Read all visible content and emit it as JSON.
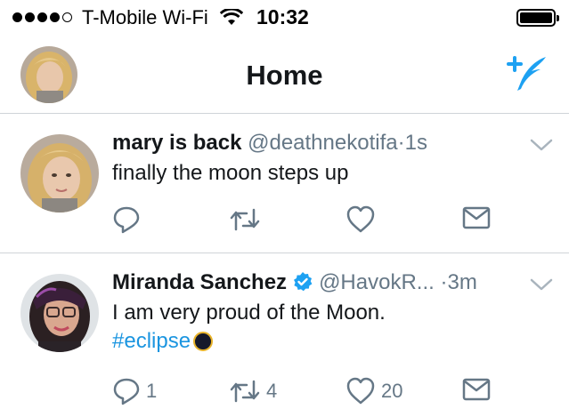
{
  "status_bar": {
    "carrier": "T-Mobile Wi-Fi",
    "time": "10:32",
    "signal_dots": 4
  },
  "nav": {
    "title": "Home",
    "accent_color": "#1da1f2"
  },
  "tweets": [
    {
      "name": "mary is back",
      "handle": "@deathnekotifa",
      "separator": "·",
      "time": "1s",
      "text": "finally the moon steps up",
      "verified": false,
      "replies": "",
      "retweets": "",
      "likes": ""
    },
    {
      "name": "Miranda Sanchez",
      "handle": "@HavokR...",
      "separator": "·",
      "time": "3m",
      "text": "I am very proud of the Moon.",
      "hashtag": "#eclipse",
      "verified": true,
      "replies": "1",
      "retweets": "4",
      "likes": "20"
    }
  ],
  "colors": {
    "text_primary": "#14171a",
    "text_secondary": "#657786",
    "link": "#1b95e0",
    "divider": "#cfd4d8"
  }
}
